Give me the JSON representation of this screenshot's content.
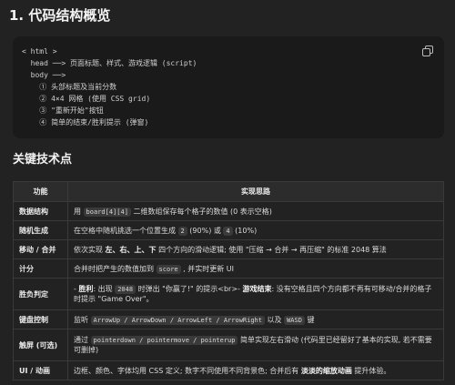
{
  "heading": "1. 代码结构概览",
  "code_lines": [
    "< html >",
    "  head ──> 页面标题、样式、游戏逻辑 (script)",
    "  body ──>",
    "    ① 头部标题及当前分数",
    "    ② 4×4 网格 (使用 CSS grid)",
    "    ③ \"重新开始\"按钮",
    "    ④ 简单的结束/胜利提示 (弹窗)"
  ],
  "subheading": "关键技术点",
  "table": {
    "headers": [
      "功能",
      "实现思路"
    ],
    "rows": [
      {
        "feature": "数据结构",
        "parts": [
          [
            "t",
            "用 "
          ],
          [
            "c",
            "board[4][4]"
          ],
          [
            "t",
            " 二维数组保存每个格子的数值 (0 表示空格)"
          ]
        ]
      },
      {
        "feature": "随机生成",
        "parts": [
          [
            "t",
            "在空格中随机挑选一个位置生成 "
          ],
          [
            "c",
            "2"
          ],
          [
            "t",
            " (90%) 或 "
          ],
          [
            "c",
            "4"
          ],
          [
            "t",
            " (10%)"
          ]
        ]
      },
      {
        "feature": "移动 / 合并",
        "parts": [
          [
            "t",
            "依次实现 "
          ],
          [
            "b",
            "左、右、上、下"
          ],
          [
            "t",
            " 四个方向的滑动逻辑; 使用 \"压缩 → 合并 → 再压缩\" 的标准 2048 算法"
          ]
        ]
      },
      {
        "feature": "计分",
        "parts": [
          [
            "t",
            "合并时把产生的数值加到 "
          ],
          [
            "c",
            "score"
          ],
          [
            "t",
            " , 并实时更新 UI"
          ]
        ]
      },
      {
        "feature": "胜负判定",
        "parts": [
          [
            "t",
            "- "
          ],
          [
            "b",
            "胜利"
          ],
          [
            "t",
            ": 出现 "
          ],
          [
            "c",
            "2048"
          ],
          [
            "t",
            " 时弹出 \"你赢了!\" 的提示<br>- "
          ],
          [
            "b",
            "游戏结束"
          ],
          [
            "t",
            ": 没有空格且四个方向都不再有可移动/合并的格子时提示 \"Game Over\"。"
          ]
        ]
      },
      {
        "feature": "键盘控制",
        "parts": [
          [
            "t",
            "监听 "
          ],
          [
            "c",
            "ArrowUp / ArrowDown / ArrowLeft / ArrowRight"
          ],
          [
            "t",
            " 以及 "
          ],
          [
            "c",
            "WASD"
          ],
          [
            "t",
            " 键"
          ]
        ]
      },
      {
        "feature": "触屏 (可选)",
        "parts": [
          [
            "t",
            "通过 "
          ],
          [
            "c",
            "pointerdown / pointermove / pointerup"
          ],
          [
            "t",
            " 简单实现左右滑动 (代码里已经留好了基本的实现, 若不需要可删掉)"
          ]
        ]
      },
      {
        "feature": "UI / 动画",
        "parts": [
          [
            "t",
            "边框、颜色、字体均用 CSS 定义; 数字不同使用不同背景色; 合并后有 "
          ],
          [
            "b",
            "淡淡的缩放动画"
          ],
          [
            "t",
            " 提升体验。"
          ]
        ]
      }
    ]
  },
  "icons": {
    "copy": "copy-icon"
  },
  "colors": {
    "background": "#222222",
    "code_bg": "#1a1a1a",
    "text": "#e8e8e8"
  }
}
